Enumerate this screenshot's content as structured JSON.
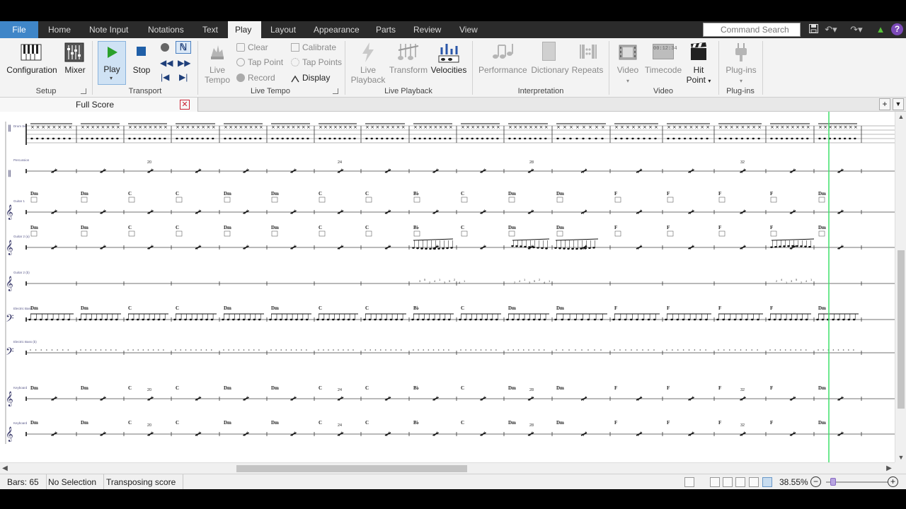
{
  "tabs": {
    "file": "File",
    "items": [
      "Home",
      "Note Input",
      "Notations",
      "Text",
      "Play",
      "Layout",
      "Appearance",
      "Parts",
      "Review",
      "View"
    ],
    "active": "Play"
  },
  "command_search": {
    "placeholder": "Command Search"
  },
  "ribbon": {
    "setup": {
      "group": "Setup",
      "configuration": "Configuration",
      "mixer": "Mixer"
    },
    "transport": {
      "group": "Transport",
      "play": "Play",
      "stop": "Stop"
    },
    "live_tempo": {
      "group": "Live Tempo",
      "live_tempo_line1": "Live",
      "live_tempo_line2": "Tempo",
      "clear": "Clear",
      "tap_point": "Tap Point",
      "record": "Record",
      "calibrate": "Calibrate",
      "tap_points": "Tap Points",
      "display": "Display"
    },
    "live_playback": {
      "group": "Live Playback",
      "live_playback_line1": "Live",
      "live_playback_line2": "Playback",
      "transform": "Transform",
      "velocities": "Velocities"
    },
    "interpretation": {
      "group": "Interpretation",
      "performance": "Performance",
      "dictionary": "Dictionary",
      "repeats": "Repeats"
    },
    "video": {
      "group": "Video",
      "video": "Video",
      "timecode": "Timecode",
      "hit_point_line1": "Hit",
      "hit_point_line2": "Point",
      "timecode_display": "00:12:34"
    },
    "plugins": {
      "group": "Plug-ins",
      "plugins": "Plug-ins"
    }
  },
  "document": {
    "tab_title": "Full Score"
  },
  "score": {
    "bar_numbers": [
      "20",
      "24",
      "28",
      "32"
    ],
    "chords": [
      "Dm",
      "Dm",
      "C",
      "C",
      "Dm",
      "Dm",
      "C",
      "C",
      "B♭",
      "C",
      "Dm",
      "Dm",
      "F",
      "F",
      "F",
      "F",
      "Dm",
      "C"
    ],
    "instruments": [
      "Drum Set",
      "Percussion",
      "Guitar 1",
      "Guitar 2 (a)",
      "Guitar 2 (b)",
      "Electric Bass",
      "Electric Bass (b)",
      "Keyboard",
      "Keyboard"
    ]
  },
  "status": {
    "bars": "Bars: 65",
    "selection": "No Selection",
    "transposing": "Transposing score",
    "zoom": "38.55%"
  },
  "colors": {
    "accent": "#3f86c8",
    "playback_line": "#3ee06a",
    "tab_bg": "#2b2b2b",
    "ribbon_bg": "#f3f3f3"
  }
}
